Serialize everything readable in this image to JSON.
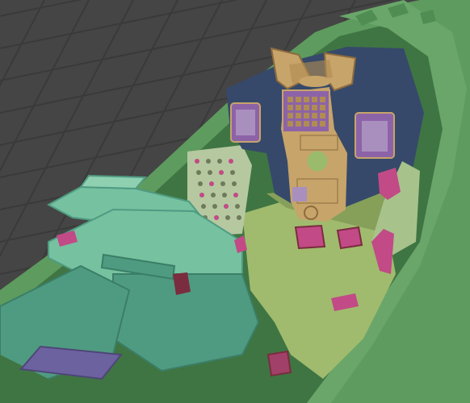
{
  "viewport": {
    "background_color": "#454545",
    "grid_color": "#3a3a3a",
    "grid_visible": true
  },
  "scene": {
    "colors": {
      "fuselage_green": "#5e9b5e",
      "fuselage_shadow": "#3f7543",
      "canopy_rail": "#6aa66a",
      "seat_teal": "#76c1a0",
      "seat_teal_dark": "#4f9b82",
      "cockpit_floor": "#a0bb6e",
      "cockpit_floor_dark": "#86a05a",
      "panel_navy": "#36496a",
      "panel_purple": "#8d63a8",
      "panel_lilac": "#a98fbe",
      "instrument_tan": "#c7a46a",
      "instrument_gold": "#b08c52",
      "magenta_accent": "#c24a86",
      "console_side": "#b6c8a0",
      "maroon": "#7a2d3e",
      "floor_plate_purple": "#6d62a0"
    }
  }
}
